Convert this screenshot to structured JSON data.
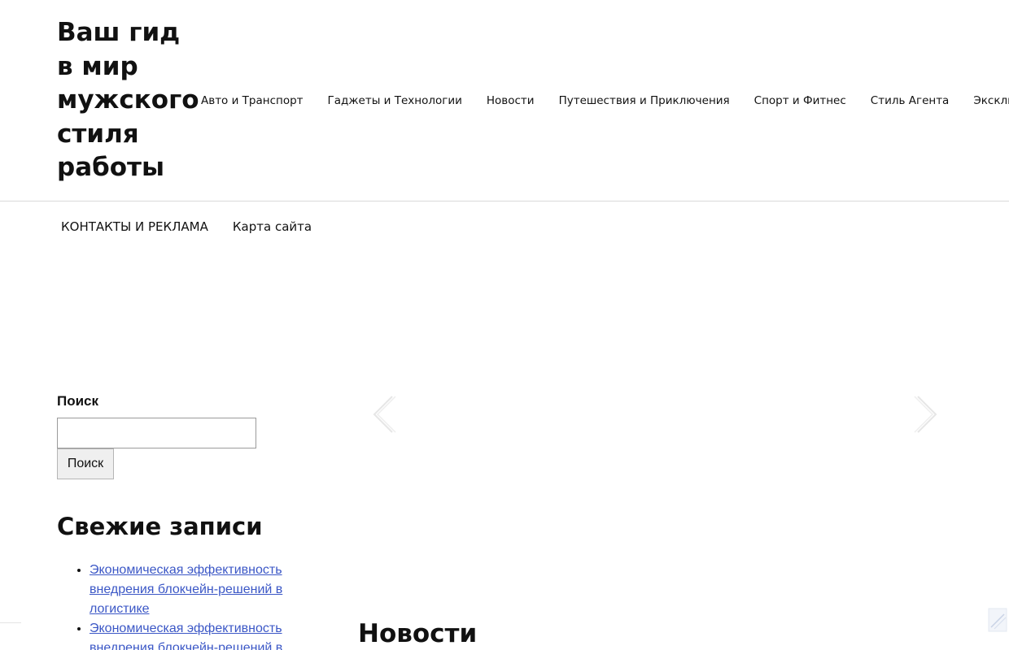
{
  "header": {
    "site_title": "Ваш гид в мир мужского стиля работы",
    "nav": [
      {
        "label": "Авто и Транспорт"
      },
      {
        "label": "Гаджеты и Технологии"
      },
      {
        "label": "Новости"
      },
      {
        "label": "Путешествия и Приключения"
      },
      {
        "label": "Спорт и Фитнес"
      },
      {
        "label": "Стиль Агента"
      },
      {
        "label": "Эксклюзив"
      }
    ]
  },
  "secondary_nav": [
    {
      "label": "КОНТАКТЫ И РЕКЛАМА"
    },
    {
      "label": "Карта сайта"
    }
  ],
  "sidebar": {
    "search": {
      "heading": "Поиск",
      "input_value": "",
      "button_label": "Поиск"
    },
    "recent_posts": {
      "heading": "Свежие записи",
      "items": [
        {
          "label": "Экономическая эффективность внедрения блокчейн-решений в логистике"
        },
        {
          "label": "Экономическая эффективность внедрения блокчейн-решений в"
        }
      ]
    }
  },
  "slider": {
    "prev_icon": "chevron-left-icon",
    "next_icon": "chevron-right-icon"
  },
  "main": {
    "news_heading": "Новости"
  },
  "colors": {
    "link": "#3b57c6",
    "text": "#111111",
    "divider": "#d9d9d9",
    "arrow": "#e6e6e6"
  }
}
